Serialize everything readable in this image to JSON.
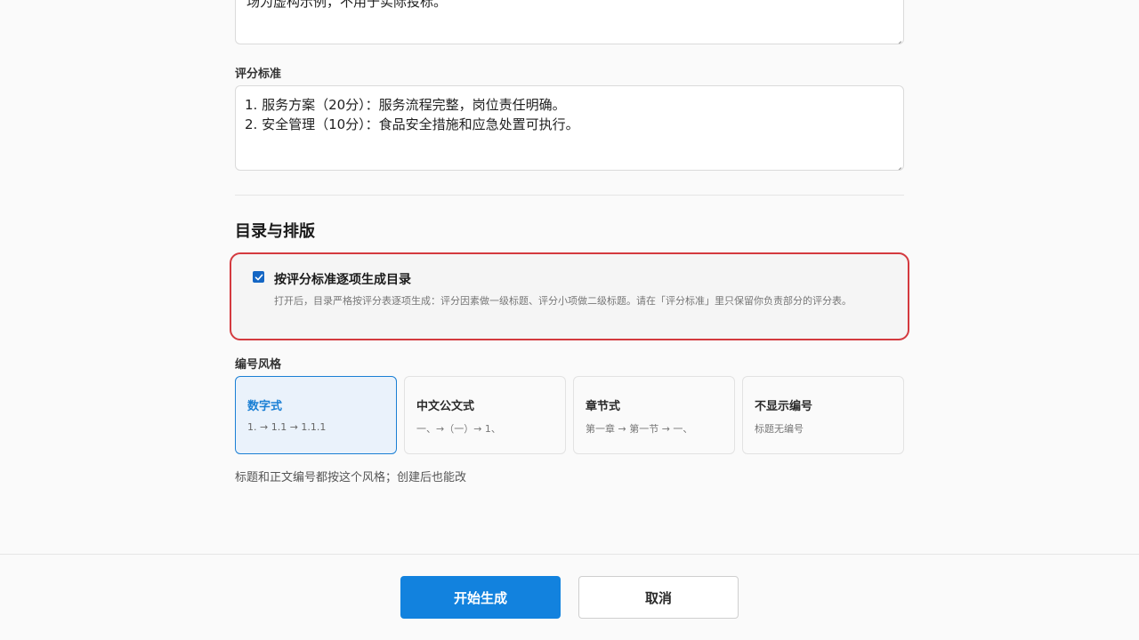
{
  "previous_field": {
    "text_partial": "场为虚构示例，不用于实际投标。"
  },
  "criteria": {
    "label": "评分标准",
    "lines": [
      "1. 服务方案（20分）：服务流程完整，岗位责任明确。",
      "2. 安全管理（10分）：食品安全措施和应急处置可执行。"
    ]
  },
  "toc_section": {
    "title": "目录与排版",
    "option": {
      "title": "按评分标准逐项生成目录",
      "description": "打开后，目录严格按评分表逐项生成：评分因素做一级标题、评分小项做二级标题。请在「评分标准」里只保留你负责部分的评分表。",
      "checked": true
    }
  },
  "numbering": {
    "label": "编号风格",
    "styles": [
      {
        "title": "数字式",
        "example": "1. → 1.1 → 1.1.1",
        "selected": true
      },
      {
        "title": "中文公文式",
        "example": "一、→（一）→ 1、",
        "selected": false
      },
      {
        "title": "章节式",
        "example": "第一章 → 第一节 → 一、",
        "selected": false
      },
      {
        "title": "不显示编号",
        "example": "标题无编号",
        "selected": false
      }
    ],
    "hint": "标题和正文编号都按这个风格；创建后也能改"
  },
  "footer": {
    "start_label": "开始生成",
    "cancel_label": "取消"
  },
  "colors": {
    "accent": "#1282de",
    "highlight_border": "#d43a3f"
  }
}
